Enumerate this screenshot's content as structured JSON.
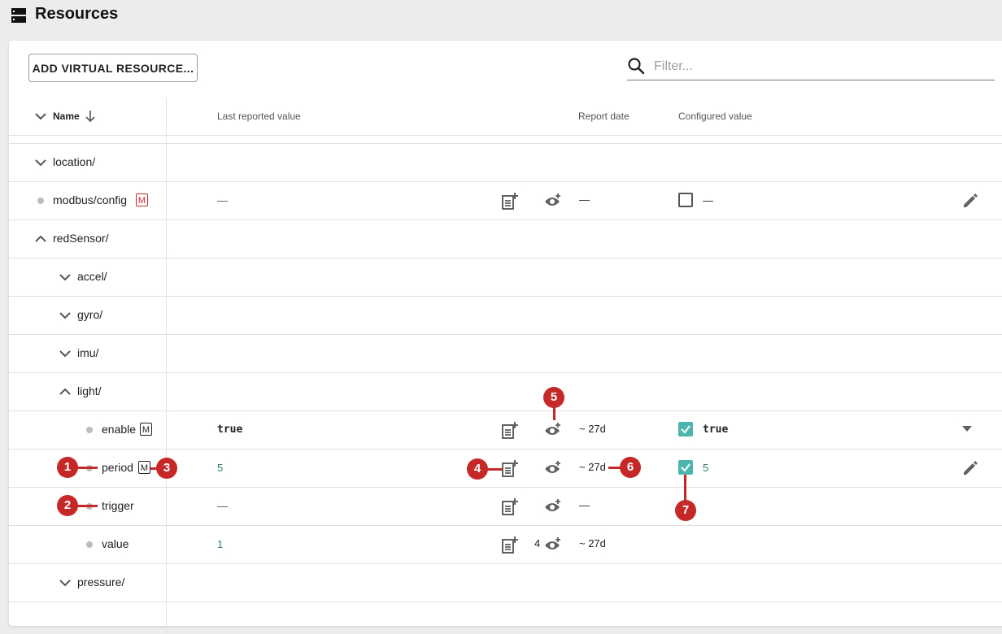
{
  "page": {
    "title": "Resources"
  },
  "toolbar": {
    "add_button": "ADD VIRTUAL RESOURCE...",
    "filter_placeholder": "Filter..."
  },
  "table": {
    "headers": {
      "name": "Name",
      "last_reported": "Last reported value",
      "report_date": "Report date",
      "configured": "Configured value"
    }
  },
  "rows": [
    {
      "name": "location/"
    },
    {
      "name": "modbus/config",
      "badge": "M",
      "value": "—",
      "date": "—",
      "configured": "—"
    },
    {
      "name": "redSensor/"
    },
    {
      "name": "accel/"
    },
    {
      "name": "gyro/"
    },
    {
      "name": "imu/"
    },
    {
      "name": "light/"
    },
    {
      "name": "enable",
      "badge": "M",
      "value": "true",
      "date": "~ 27d",
      "configured": "true"
    },
    {
      "name": "period",
      "badge": "M",
      "value": "5",
      "date": "~ 27d",
      "configured": "5"
    },
    {
      "name": "trigger",
      "value": "—",
      "date": "—"
    },
    {
      "name": "value",
      "value": "1",
      "observers": "4",
      "date": "~ 27d"
    },
    {
      "name": "pressure/"
    }
  ],
  "callouts": [
    "1",
    "2",
    "3",
    "4",
    "5",
    "6",
    "7"
  ],
  "colors": {
    "accent_red": "#c62828",
    "checkbox_teal": "#4db6ac",
    "numeric_green": "#2e7d5b"
  }
}
